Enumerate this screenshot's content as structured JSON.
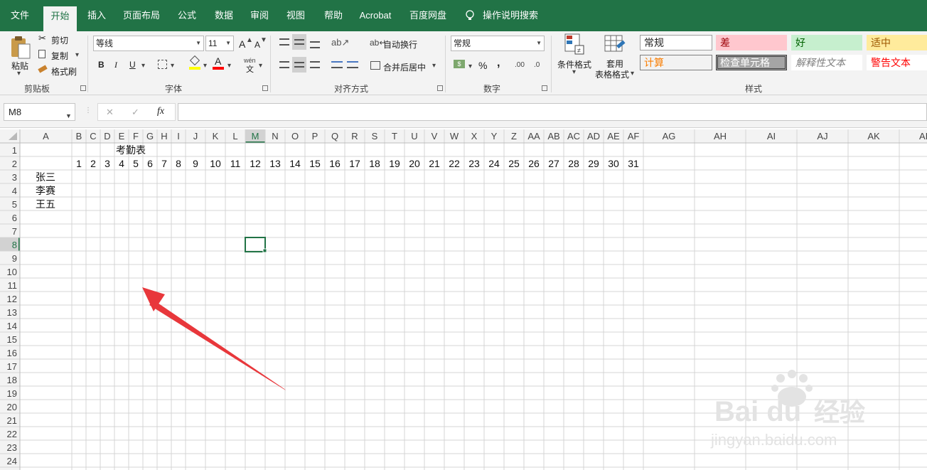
{
  "tabs": [
    {
      "label": "文件",
      "active": false
    },
    {
      "label": "开始",
      "active": true
    },
    {
      "label": "插入",
      "active": false
    },
    {
      "label": "页面布局",
      "active": false
    },
    {
      "label": "公式",
      "active": false
    },
    {
      "label": "数据",
      "active": false
    },
    {
      "label": "审阅",
      "active": false
    },
    {
      "label": "视图",
      "active": false
    },
    {
      "label": "帮助",
      "active": false
    },
    {
      "label": "Acrobat",
      "active": false
    },
    {
      "label": "百度网盘",
      "active": false
    }
  ],
  "search": {
    "label": "操作说明搜索",
    "icon": "lightbulb-icon"
  },
  "clipboard": {
    "paste": "粘贴",
    "cut": "剪切",
    "copy": "复制",
    "format_painter": "格式刷",
    "group": "剪贴板"
  },
  "font": {
    "name": "等线",
    "size": "11",
    "grow": "A",
    "shrink": "A",
    "bold": "B",
    "italic": "I",
    "underline": "U",
    "color_letter": "A",
    "phonetic_top": "wén",
    "phonetic_bottom": "文",
    "group": "字体",
    "fill_color": "#ffff00",
    "text_color": "#ff0000"
  },
  "alignment": {
    "wrap": "自动换行",
    "merge": "合并后居中",
    "group": "对齐方式"
  },
  "number": {
    "format": "常规",
    "currency": "$",
    "percent": "%",
    "comma": ",",
    "inc_decimal": ".00",
    "dec_decimal": ".0",
    "group": "数字"
  },
  "styles": {
    "conditional": "条件格式",
    "table_line1": "套用",
    "table_line2": "表格格式",
    "group": "样式",
    "cells": [
      {
        "label": "常规",
        "bg": "#ffffff",
        "color": "#222222",
        "border": "#9e9e9e"
      },
      {
        "label": "差",
        "bg": "#ffc7ce",
        "color": "#9c0006",
        "border": "#ffc7ce"
      },
      {
        "label": "好",
        "bg": "#c6efce",
        "color": "#006100",
        "border": "#c6efce"
      },
      {
        "label": "适中",
        "bg": "#ffeb9c",
        "color": "#9c5700",
        "border": "#ffeb9c"
      },
      {
        "label": "计算",
        "bg": "#f2f2f2",
        "color": "#fa7d00",
        "border": "#7f7f7f"
      },
      {
        "label": "检查单元格",
        "bg": "#a5a5a5",
        "color": "#ffffff",
        "border": "#3f3f3f"
      },
      {
        "label": "解释性文本",
        "bg": "#ffffff",
        "color": "#7f7f7f",
        "border": "#ffffff"
      },
      {
        "label": "警告文本",
        "bg": "#ffffff",
        "color": "#ff0000",
        "border": "#ffffff"
      }
    ]
  },
  "formula_bar": {
    "name_box": "M8",
    "cancel": "✕",
    "enter": "✓",
    "fx": "fx",
    "value": ""
  },
  "sheet": {
    "columns": [
      "A",
      "B",
      "C",
      "D",
      "E",
      "F",
      "G",
      "H",
      "I",
      "J",
      "K",
      "L",
      "M",
      "N",
      "O",
      "P",
      "Q",
      "R",
      "S",
      "T",
      "U",
      "V",
      "W",
      "X",
      "Y",
      "Z",
      "AA",
      "AB",
      "AC",
      "AD",
      "AE",
      "AF",
      "AG",
      "AH",
      "AI",
      "AJ",
      "AK",
      "AL"
    ],
    "rows": [
      1,
      2,
      3,
      4,
      5,
      6,
      7,
      8,
      9,
      10,
      11,
      12,
      13,
      14,
      15,
      16,
      17,
      18,
      19,
      20,
      21,
      22,
      23,
      24
    ],
    "title": "考勤表",
    "days": [
      "1",
      "2",
      "3",
      "4",
      "5",
      "6",
      "7",
      "8",
      "9",
      "10",
      "11",
      "12",
      "13",
      "14",
      "15",
      "16",
      "17",
      "18",
      "19",
      "20",
      "21",
      "22",
      "23",
      "24",
      "25",
      "26",
      "27",
      "28",
      "29",
      "30",
      "31"
    ],
    "names": [
      "张三",
      "李赛",
      "王五"
    ],
    "selected": "M8",
    "accent": "#217346",
    "annotation_color": "#e8373b"
  },
  "watermark": {
    "brand": "Bai du",
    "site": "jingyan.baidu.com",
    "word": "经验"
  }
}
